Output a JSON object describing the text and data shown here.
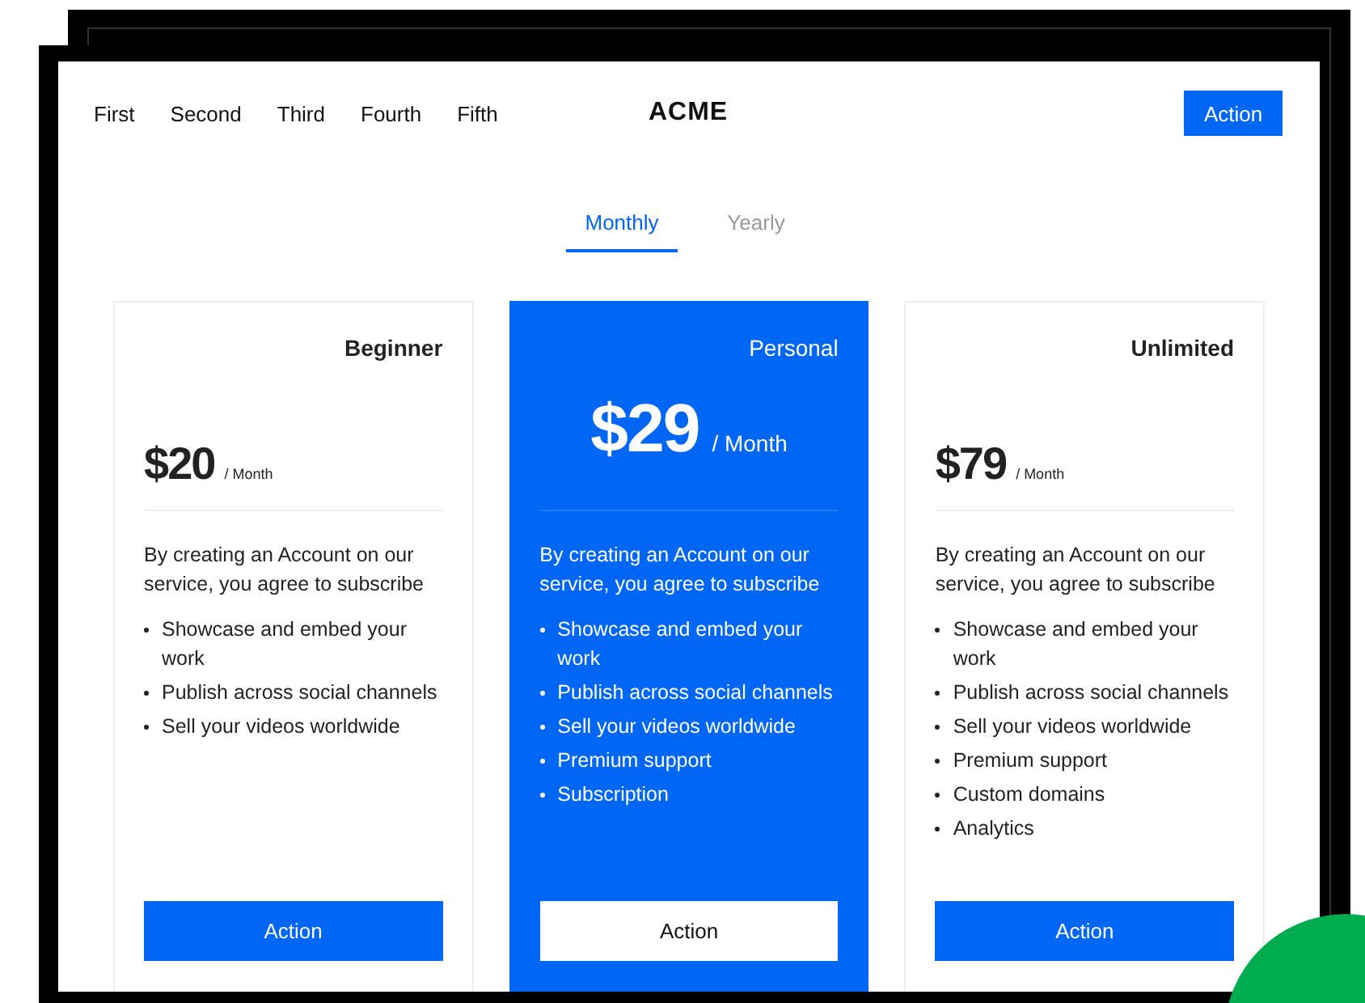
{
  "nav": {
    "links": [
      "First",
      "Second",
      "Third",
      "Fourth",
      "Fifth"
    ],
    "logo": "ACME",
    "action": "Action"
  },
  "tabs": [
    {
      "label": "Monthly",
      "selected": true
    },
    {
      "label": "Yearly",
      "selected": false
    }
  ],
  "plans": [
    {
      "name": "Beginner",
      "price": "$20",
      "period": "/ Month",
      "featured": false,
      "description": "By creating an Account on our service, you agree to subscribe",
      "features": [
        "Showcase and embed your work",
        "Publish across social channels",
        "Sell your videos worldwide"
      ],
      "action": "Action"
    },
    {
      "name": "Personal",
      "price": "$29",
      "period": "/ Month",
      "featured": true,
      "description": "By creating an Account on our service, you agree to subscribe",
      "features": [
        "Showcase and embed your work",
        "Publish across social channels",
        "Sell your videos worldwide",
        "Premium support",
        "Subscription"
      ],
      "action": "Action"
    },
    {
      "name": "Unlimited",
      "price": "$79",
      "period": "/ Month",
      "featured": false,
      "description": "By creating an Account on our service, you agree to subscribe",
      "features": [
        "Showcase and embed your work",
        "Publish across social channels",
        "Sell your videos worldwide",
        "Premium support",
        "Custom domains",
        "Analytics"
      ],
      "action": "Action"
    }
  ]
}
